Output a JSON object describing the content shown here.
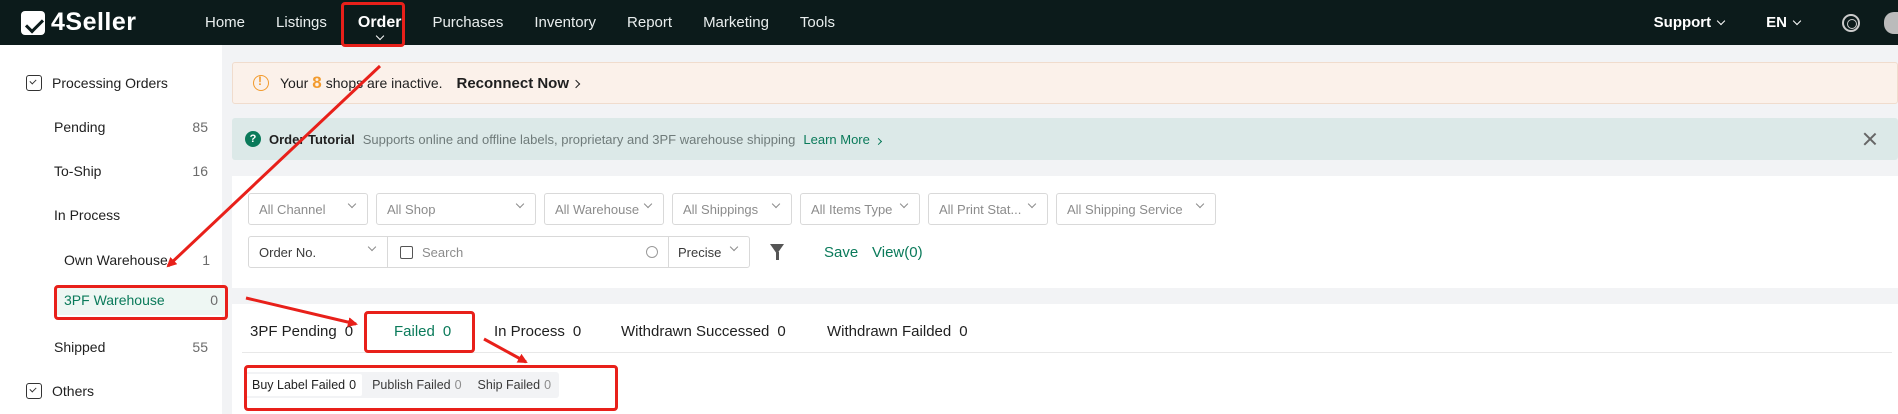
{
  "app": {
    "name": "4Seller"
  },
  "nav": {
    "items": [
      "Home",
      "Listings",
      "Order",
      "Purchases",
      "Inventory",
      "Report",
      "Marketing",
      "Tools"
    ],
    "active": "Order",
    "support": "Support",
    "language": "EN"
  },
  "sidebar": {
    "processing_orders": "Processing Orders",
    "pending": {
      "label": "Pending",
      "count": "85"
    },
    "to_ship": {
      "label": "To-Ship",
      "count": "16"
    },
    "in_process": "In Process",
    "own_warehouse": {
      "label": "Own Warehouse",
      "count": "1"
    },
    "third_party_warehouse": {
      "label": "3PF Warehouse",
      "count": "0"
    },
    "shipped": {
      "label": "Shipped",
      "count": "55"
    },
    "others": "Others"
  },
  "alert": {
    "prefix": "Your",
    "number": "8",
    "suffix": "shops are inactive.",
    "action": "Reconnect Now"
  },
  "tutorial": {
    "title": "Order Tutorial",
    "description": "Supports online and offline labels, proprietary and 3PF warehouse shipping",
    "link": "Learn More"
  },
  "filters": {
    "channel": "All Channel",
    "shop": "All Shop",
    "warehouse": "All Warehouse",
    "shippings": "All Shippings",
    "items_type": "All Items Type",
    "print_status": "All Print Stat...",
    "shipping_service": "All Shipping Service",
    "order_no": "Order No.",
    "search_placeholder": "Search",
    "precise": "Precise",
    "save": "Save",
    "view": "View(0)"
  },
  "tabs": [
    {
      "label": "3PF Pending",
      "count": "0"
    },
    {
      "label": "Failed",
      "count": "0"
    },
    {
      "label": "In Process",
      "count": "0"
    },
    {
      "label": "Withdrawn Successed",
      "count": "0"
    },
    {
      "label": "Withdrawn Failded",
      "count": "0"
    }
  ],
  "subtabs": [
    {
      "label": "Buy Label Failed",
      "count": "0"
    },
    {
      "label": "Publish Failed",
      "count": "0"
    },
    {
      "label": "Ship Failed",
      "count": "0"
    }
  ],
  "colors": {
    "brand_green": "#0a7a5a",
    "annotation_red": "#e8201a",
    "topbar": "#0c1b1b",
    "warning_orange": "#f29b2e"
  }
}
